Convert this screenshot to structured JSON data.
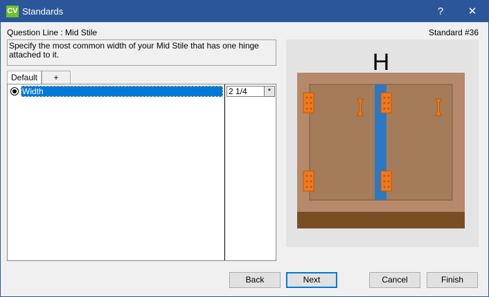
{
  "window": {
    "app_icon_text": "CV",
    "title": "Standards",
    "help_label": "?",
    "close_label": "✕",
    "accent_color": "#2b579a"
  },
  "header": {
    "question_line": "Question Line : Mid Stile",
    "standard_number": "Standard #36"
  },
  "description": "Specify the most common width of your Mid Stile that has one hinge attached to it.",
  "tabs": [
    {
      "label": "Default",
      "active": true
    },
    {
      "label": "+",
      "active": false
    }
  ],
  "grid": {
    "rows": [
      {
        "label": "Width",
        "value": "2 1/4",
        "selected": true,
        "dropdown_glyph": "*"
      }
    ]
  },
  "preview": {
    "letter": "H",
    "icons": [
      "hinge-icon",
      "door-handle-icon"
    ],
    "colors": {
      "cabinet": "#b5896a",
      "door": "#a47c59",
      "stile": "#2b79c2",
      "base": "#7a4e25",
      "hardware": "#f07820"
    }
  },
  "buttons": {
    "back": "Back",
    "next": "Next",
    "cancel": "Cancel",
    "finish": "Finish"
  }
}
